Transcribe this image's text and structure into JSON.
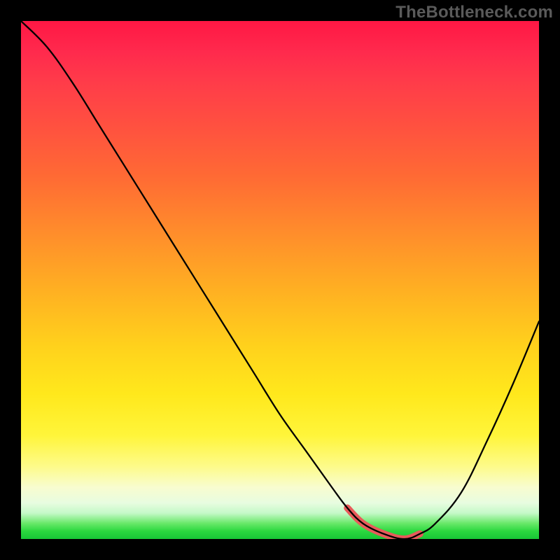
{
  "watermark": "TheBottleneck.com",
  "chart_data": {
    "type": "line",
    "title": "",
    "xlabel": "",
    "ylabel": "",
    "xlim": [
      0,
      100
    ],
    "ylim": [
      0,
      100
    ],
    "grid": false,
    "legend": false,
    "series": [
      {
        "name": "bottleneck-curve",
        "color": "#000000",
        "x": [
          0,
          5,
          10,
          15,
          20,
          25,
          30,
          35,
          40,
          45,
          50,
          55,
          60,
          63,
          66,
          70,
          74,
          77,
          80,
          85,
          90,
          95,
          100
        ],
        "y": [
          100,
          95,
          88,
          80,
          72,
          64,
          56,
          48,
          40,
          32,
          24,
          17,
          10,
          6,
          3,
          1,
          0,
          1,
          3,
          9,
          19,
          30,
          42
        ]
      }
    ],
    "highlight": {
      "name": "optimal-region",
      "color": "#E75A5A",
      "x": [
        63,
        66,
        70,
        74,
        77
      ],
      "y": [
        6,
        3,
        1,
        0,
        1
      ]
    }
  }
}
